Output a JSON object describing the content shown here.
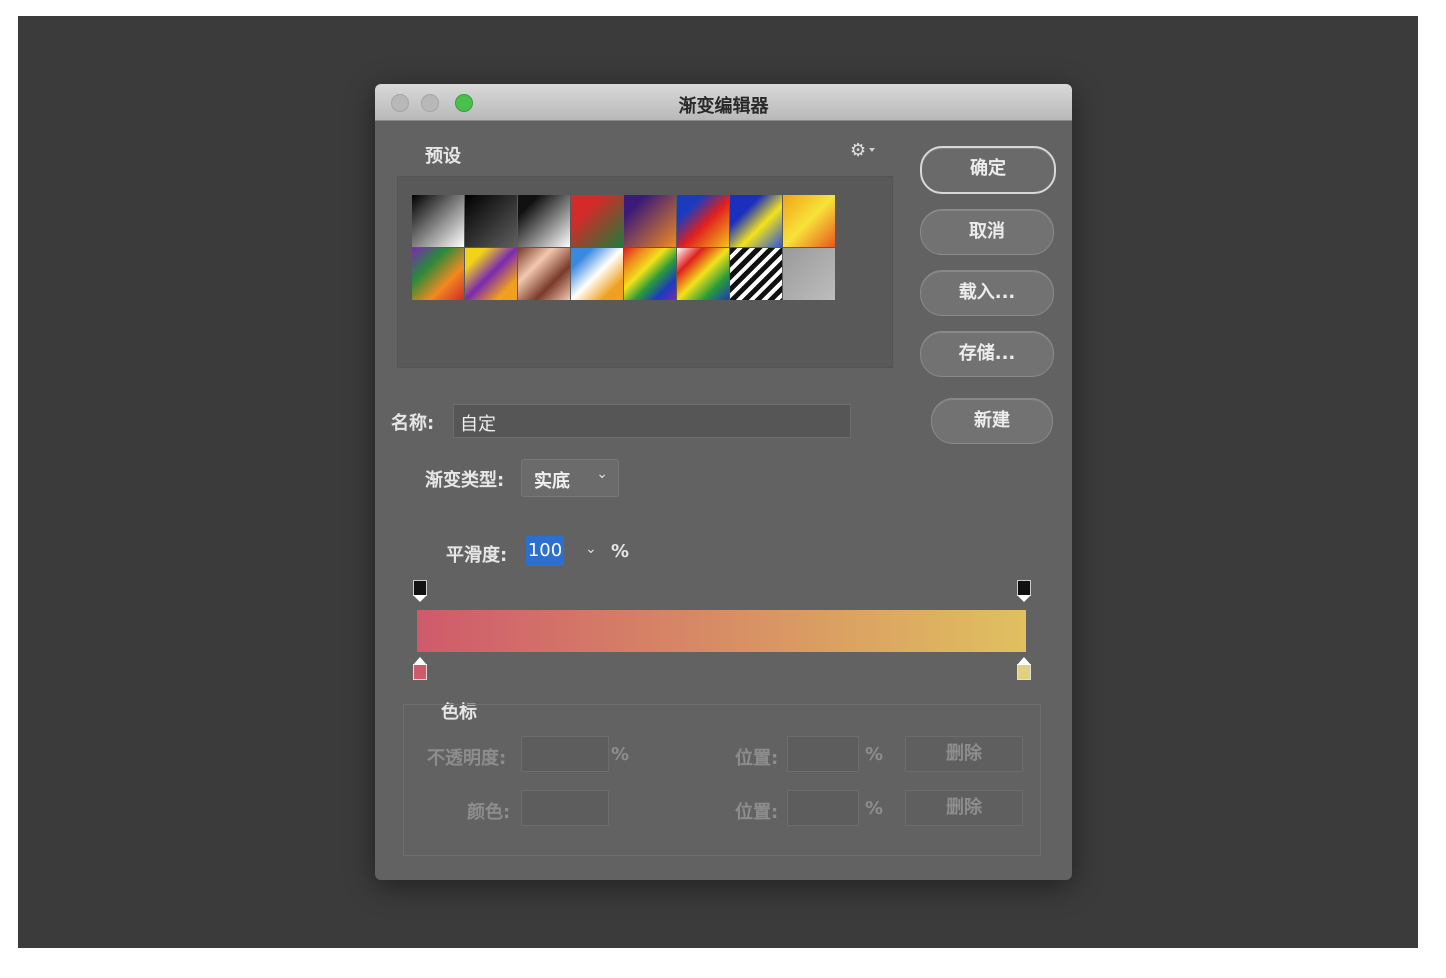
{
  "dialog": {
    "title": "渐变编辑器",
    "presets_label": "预设",
    "buttons": {
      "ok": "确定",
      "cancel": "取消",
      "load": "载入...",
      "save": "存储...",
      "new": "新建"
    },
    "name_label": "名称:",
    "name_value": "自定",
    "gradient_type_label": "渐变类型:",
    "gradient_type_value": "实底",
    "smoothness_label": "平滑度:",
    "smoothness_value": "100",
    "smoothness_unit": "%",
    "gradient_colors": {
      "start": "#cf5a6b",
      "end": "#e0c05f"
    },
    "stops_label": "色标",
    "opacity_label": "不透明度:",
    "opacity_unit": "%",
    "color_label": "颜色:",
    "location_label": "位置:",
    "location_unit": "%",
    "delete_label": "删除",
    "delete_label_2": "删除"
  },
  "icons": {
    "gear": "gear-icon",
    "dropdown": "chevron-down-icon"
  }
}
